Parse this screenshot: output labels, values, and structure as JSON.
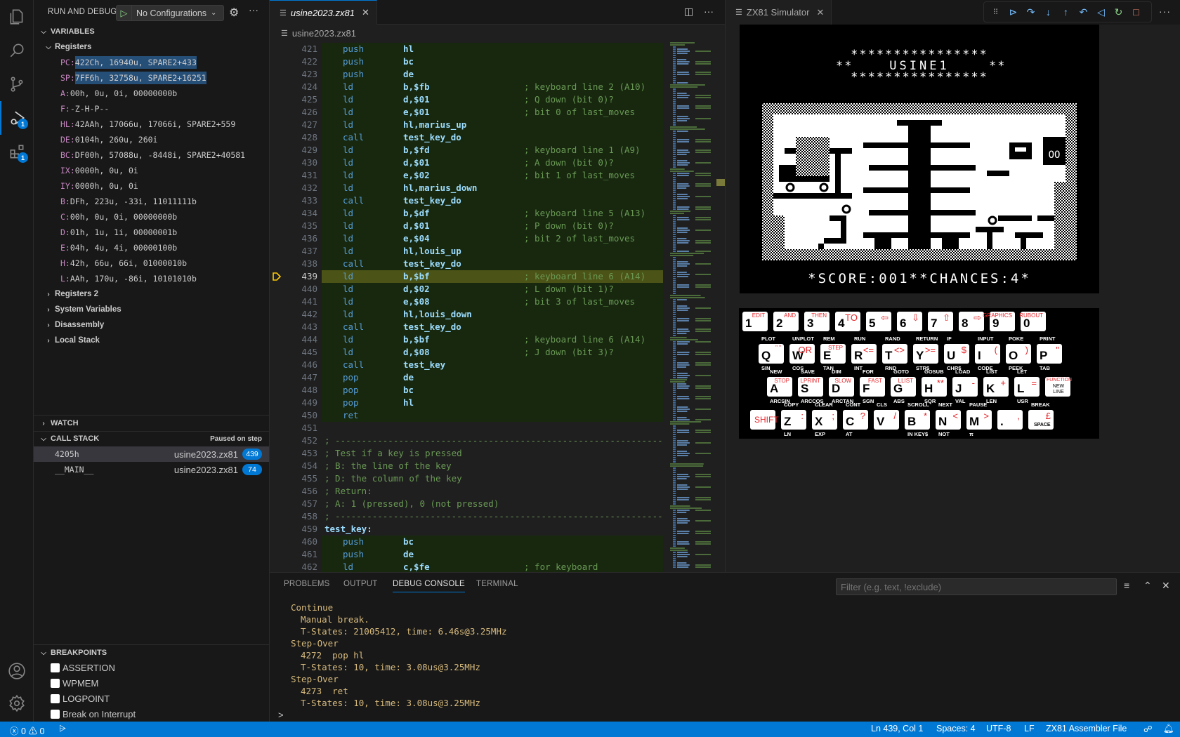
{
  "activity_bar": {
    "items": [
      {
        "name": "explorer-icon"
      },
      {
        "name": "search-icon"
      },
      {
        "name": "source-control-icon"
      },
      {
        "name": "run-debug-icon",
        "badge": "1",
        "active": true
      },
      {
        "name": "extensions-icon",
        "badge": "1"
      }
    ],
    "bottom": [
      {
        "name": "account-icon"
      },
      {
        "name": "manage-gear-icon"
      }
    ]
  },
  "sidebar": {
    "title": "RUN AND DEBUG",
    "config": "No Configurations",
    "variables": {
      "header": "VARIABLES",
      "registers_label": "Registers",
      "registers": [
        {
          "k": "PC:",
          "v": "422Ch, 16940u, SPARE2+433",
          "sel": true
        },
        {
          "k": "SP:",
          "v": "7FF6h, 32758u, SPARE2+16251",
          "sel": true
        },
        {
          "k": "A:",
          "v": "00h, 0u, 0i, 00000000b"
        },
        {
          "k": "F:",
          "v": "-Z-H-P--"
        },
        {
          "k": "HL:",
          "v": "42AAh, 17066u, 17066i, SPARE2+559"
        },
        {
          "k": "DE:",
          "v": "0104h, 260u, 260i"
        },
        {
          "k": "BC:",
          "v": "DF00h, 57088u, -8448i, SPARE2+40581"
        },
        {
          "k": "IX:",
          "v": "0000h, 0u, 0i"
        },
        {
          "k": "IY:",
          "v": "0000h, 0u, 0i"
        },
        {
          "k": "B:",
          "v": "DFh, 223u, -33i, 11011111b"
        },
        {
          "k": "C:",
          "v": "00h, 0u, 0i, 00000000b"
        },
        {
          "k": "D:",
          "v": "01h, 1u, 1i, 00000001b"
        },
        {
          "k": "E:",
          "v": "04h, 4u, 4i, 00000100b"
        },
        {
          "k": "H:",
          "v": "42h, 66u, 66i, 01000010b"
        },
        {
          "k": "L:",
          "v": "AAh, 170u, -86i, 10101010b"
        }
      ],
      "collapsed": [
        "Registers 2",
        "System Variables",
        "Disassembly",
        "Local Stack"
      ]
    },
    "watch": {
      "header": "WATCH"
    },
    "call_stack": {
      "header": "CALL STACK",
      "status": "Paused on step",
      "frames": [
        {
          "fn": "4205h",
          "file": "usine2023.zx81",
          "line": "439",
          "sel": true
        },
        {
          "fn": "__MAIN__",
          "file": "usine2023.zx81",
          "line": "74"
        }
      ]
    },
    "breakpoints": {
      "header": "BREAKPOINTS",
      "items": [
        {
          "label": "ASSERTION",
          "checked": false
        },
        {
          "label": "WPMEM",
          "checked": false
        },
        {
          "label": "LOGPOINT",
          "checked": false
        },
        {
          "label": "Break on Interrupt",
          "checked": false
        }
      ]
    }
  },
  "editor": {
    "tab": "usine2023.zx81",
    "breadcrumb": "usine2023.zx81",
    "current_line": 439,
    "lines": [
      {
        "n": 421,
        "op": "push",
        "arg": "hl",
        "hl": true
      },
      {
        "n": 422,
        "op": "push",
        "arg": "bc",
        "hl": true
      },
      {
        "n": 423,
        "op": "push",
        "arg": "de",
        "hl": true
      },
      {
        "n": 424,
        "op": "ld",
        "arg": "b,$fb",
        "cm": "; keyboard line 2 (A10)",
        "hl": true
      },
      {
        "n": 425,
        "op": "ld",
        "arg": "d,$01",
        "cm": "; Q down (bit 0)?",
        "hl": true
      },
      {
        "n": 426,
        "op": "ld",
        "arg": "e,$01",
        "cm": "; bit 0 of last_moves",
        "hl": true
      },
      {
        "n": 427,
        "op": "ld",
        "arg": "hl,marius_up",
        "hl": true
      },
      {
        "n": 428,
        "op": "call",
        "arg": "test_key_do",
        "hl": true
      },
      {
        "n": 429,
        "op": "ld",
        "arg": "b,$fd",
        "cm": "; keyboard line 1 (A9)",
        "hl": true
      },
      {
        "n": 430,
        "op": "ld",
        "arg": "d,$01",
        "cm": "; A down (bit 0)?",
        "hl": true
      },
      {
        "n": 431,
        "op": "ld",
        "arg": "e,$02",
        "cm": "; bit 1 of last_moves",
        "hl": true
      },
      {
        "n": 432,
        "op": "ld",
        "arg": "hl,marius_down",
        "hl": true
      },
      {
        "n": 433,
        "op": "call",
        "arg": "test_key_do",
        "hl": true
      },
      {
        "n": 434,
        "op": "ld",
        "arg": "b,$df",
        "cm": "; keyboard line 5 (A13)",
        "hl": true
      },
      {
        "n": 435,
        "op": "ld",
        "arg": "d,$01",
        "cm": "; P down (bit 0)?",
        "hl": true
      },
      {
        "n": 436,
        "op": "ld",
        "arg": "e,$04",
        "cm": "; bit 2 of last_moves",
        "hl": true
      },
      {
        "n": 437,
        "op": "ld",
        "arg": "hl,louis_up",
        "hl": true
      },
      {
        "n": 438,
        "op": "call",
        "arg": "test_key_do",
        "hl": true
      },
      {
        "n": 439,
        "op": "ld",
        "arg": "b,$bf",
        "cm": "; keyboard line 6 (A14)",
        "hl": true,
        "bp": true
      },
      {
        "n": 440,
        "op": "ld",
        "arg": "d,$02",
        "cm": "; L down (bit 1)?",
        "hl": true
      },
      {
        "n": 441,
        "op": "ld",
        "arg": "e,$08",
        "cm": "; bit 3 of last_moves",
        "hl": true
      },
      {
        "n": 442,
        "op": "ld",
        "arg": "hl,louis_down",
        "hl": true
      },
      {
        "n": 443,
        "op": "call",
        "arg": "test_key_do",
        "hl": true
      },
      {
        "n": 444,
        "op": "ld",
        "arg": "b,$bf",
        "cm": "; keyboard line 6 (A14)",
        "hl": true
      },
      {
        "n": 445,
        "op": "ld",
        "arg": "d,$08",
        "cm": "; J down (bit 3)?",
        "hl": true
      },
      {
        "n": 446,
        "op": "call",
        "arg": "test_key",
        "hl": true
      },
      {
        "n": 447,
        "op": "pop",
        "arg": "de",
        "hl": true
      },
      {
        "n": 448,
        "op": "pop",
        "arg": "bc",
        "hl": true
      },
      {
        "n": 449,
        "op": "pop",
        "arg": "hl",
        "hl": true
      },
      {
        "n": 450,
        "op": "ret",
        "arg": "",
        "hl": true
      },
      {
        "n": 451
      },
      {
        "n": 452,
        "full": "; -----------------------------------------------------------------"
      },
      {
        "n": 453,
        "full": "; Test if a key is pressed"
      },
      {
        "n": 454,
        "full": "; B: the line of the key"
      },
      {
        "n": 455,
        "full": "; D: the column of the key"
      },
      {
        "n": 456,
        "full": "; Return:"
      },
      {
        "n": 457,
        "full": "; A: 1 (pressed), 0 (not pressed)"
      },
      {
        "n": 458,
        "full": "; -----------------------------------------------------------------"
      },
      {
        "n": 459,
        "label": "test_key:"
      },
      {
        "n": 460,
        "op": "push",
        "arg": "bc",
        "hl": true
      },
      {
        "n": 461,
        "op": "push",
        "arg": "de",
        "hl": true
      },
      {
        "n": 462,
        "op": "ld",
        "arg": "c,$fe",
        "cm": "; for keyboard",
        "hl": true
      }
    ]
  },
  "simulator": {
    "tab": "ZX81 Simulator",
    "screen": {
      "title_line": "USINE1",
      "score_line": "*SCORE:001**CHANCES:4*",
      "score": "001",
      "chances": "4"
    },
    "keyboard": {
      "row1": [
        {
          "k": "1",
          "top": "EDIT"
        },
        {
          "k": "2",
          "top": "AND"
        },
        {
          "k": "3",
          "top": "THEN"
        },
        {
          "k": "4",
          "top": "TO"
        },
        {
          "k": "5",
          "top": "⇦"
        },
        {
          "k": "6",
          "top": "⇩"
        },
        {
          "k": "7",
          "top": "⇧"
        },
        {
          "k": "8",
          "top": "⇨"
        },
        {
          "k": "9",
          "top": "GRAPHICS"
        },
        {
          "k": "0",
          "top": "RUBOUT"
        }
      ],
      "row2": [
        {
          "k": "Q",
          "above": "PLOT",
          "sym": "\" \"",
          "below": "SIN"
        },
        {
          "k": "W",
          "above": "UNPLOT",
          "sym": "OR",
          "below": "COS"
        },
        {
          "k": "E",
          "above": "REM",
          "sym": "STEP",
          "below": "TAN"
        },
        {
          "k": "R",
          "above": "RUN",
          "sym": "<=",
          "below": "INT"
        },
        {
          "k": "T",
          "above": "RAND",
          "sym": "<>",
          "below": "RND"
        },
        {
          "k": "Y",
          "above": "RETURN",
          "sym": ">=",
          "below": "STR$"
        },
        {
          "k": "U",
          "above": "IF",
          "sym": "$",
          "below": "CHR$"
        },
        {
          "k": "I",
          "above": "INPUT",
          "sym": "(",
          "below": "CODE"
        },
        {
          "k": "O",
          "above": "POKE",
          "sym": ")",
          "below": "PEEK"
        },
        {
          "k": "P",
          "above": "PRINT",
          "sym": "\"",
          "below": "TAB"
        }
      ],
      "row3": [
        {
          "k": "A",
          "above": "NEW",
          "sym": "STOP",
          "below": "ARCSIN"
        },
        {
          "k": "S",
          "above": "SAVE",
          "sym": "LPRINT",
          "below": "ARCCOS"
        },
        {
          "k": "D",
          "above": "DIM",
          "sym": "SLOW",
          "below": "ARCTAN"
        },
        {
          "k": "F",
          "above": "FOR",
          "sym": "FAST",
          "below": "SGN"
        },
        {
          "k": "G",
          "above": "GOTO",
          "sym": "LLIST",
          "below": "ABS"
        },
        {
          "k": "H",
          "above": "GOSUB",
          "sym": "**",
          "below": "SQR"
        },
        {
          "k": "J",
          "above": "LOAD",
          "sym": "-",
          "below": "VAL"
        },
        {
          "k": "K",
          "above": "LIST",
          "sym": "+",
          "below": "LEN"
        },
        {
          "k": "L",
          "above": "LET",
          "sym": "=",
          "below": "USR"
        },
        {
          "k": "NEW LINE",
          "sym": "FUNCTION"
        }
      ],
      "row4": [
        {
          "k": "SHIFT"
        },
        {
          "k": "Z",
          "above": "COPY",
          "sym": ":",
          "below": "LN"
        },
        {
          "k": "X",
          "above": "CLEAR",
          "sym": ";",
          "below": "EXP"
        },
        {
          "k": "C",
          "above": "CONT",
          "sym": "?",
          "below": "AT"
        },
        {
          "k": "V",
          "above": "CLS",
          "sym": "/",
          "below": ""
        },
        {
          "k": "B",
          "above": "SCROLL",
          "sym": "*",
          "below": "IN KEY$"
        },
        {
          "k": "N",
          "above": "NEXT",
          "sym": "<",
          "below": "NOT"
        },
        {
          "k": "M",
          "above": "PAUSE",
          "sym": ">",
          "below": "π"
        },
        {
          "k": ".",
          "sym": ","
        },
        {
          "k": "SPACE",
          "above": "BREAK",
          "sym": "£"
        }
      ]
    }
  },
  "debug_toolbar": {
    "buttons": [
      {
        "name": "continue",
        "glyph": "⊳",
        "color": "#75beff"
      },
      {
        "name": "step-over",
        "glyph": "↷",
        "color": "#75beff"
      },
      {
        "name": "step-into",
        "glyph": "↓",
        "color": "#75beff"
      },
      {
        "name": "step-out",
        "glyph": "↑",
        "color": "#75beff"
      },
      {
        "name": "step-back",
        "glyph": "↶",
        "color": "#75beff"
      },
      {
        "name": "reverse-continue",
        "glyph": "◁",
        "color": "#75beff"
      },
      {
        "name": "restart",
        "glyph": "↻",
        "color": "#89d185"
      },
      {
        "name": "stop",
        "glyph": "□",
        "color": "#f48771"
      }
    ]
  },
  "panel": {
    "tabs": [
      "PROBLEMS",
      "OUTPUT",
      "DEBUG CONSOLE",
      "TERMINAL"
    ],
    "active_tab": "DEBUG CONSOLE",
    "filter_placeholder": "Filter (e.g. text, !exclude)",
    "console": [
      {
        "t": "Continue",
        "ind": false
      },
      {
        "t": "Manual break.",
        "ind": true
      },
      {
        "t": "T-States: 21005412, time: 6.46s@3.25MHz",
        "ind": true
      },
      {
        "t": "Step-Over",
        "ind": false
      },
      {
        "t": "4272  pop hl",
        "ind": true
      },
      {
        "t": "T-States: 10, time: 3.08us@3.25MHz",
        "ind": true
      },
      {
        "t": "Step-Over",
        "ind": false
      },
      {
        "t": "4273  ret",
        "ind": true
      },
      {
        "t": "T-States: 10, time: 3.08us@3.25MHz",
        "ind": true
      }
    ],
    "prompt": ">"
  },
  "status_bar": {
    "errors": "0",
    "warnings": "0",
    "position": "Ln 439, Col 1",
    "spaces": "Spaces: 4",
    "encoding": "UTF-8",
    "eol": "LF",
    "language": "ZX81 Assembler File"
  },
  "colors": {
    "accent": "#0078d4",
    "status_bar": "#0078d4",
    "bp_line": "#4b5316",
    "covered_line": "#17280f",
    "console_text": "#d7ba7d",
    "key_red": "#e8262b"
  }
}
